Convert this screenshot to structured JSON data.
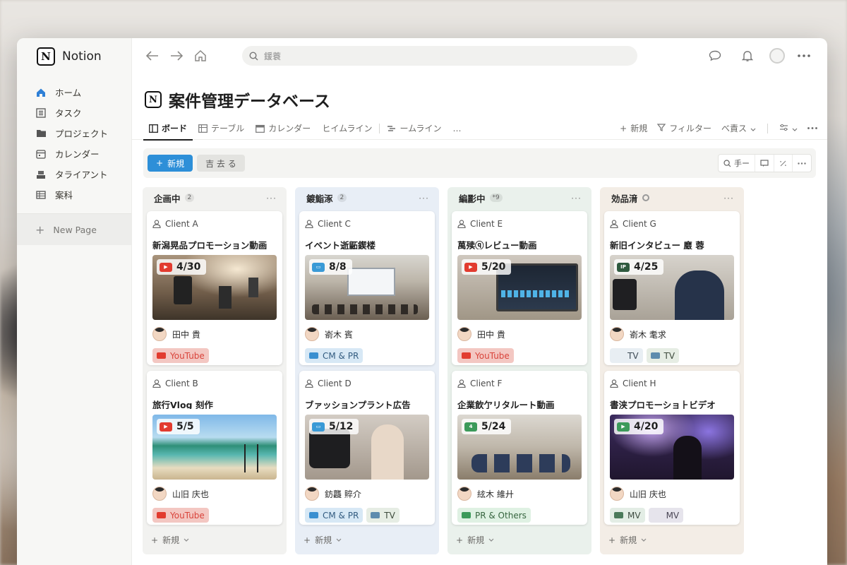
{
  "app": {
    "name": "Notion"
  },
  "sidebar": {
    "items": [
      {
        "label": "ホーム",
        "icon": "home-icon",
        "active": true
      },
      {
        "label": "タスク",
        "icon": "task-icon"
      },
      {
        "label": "プロジェクト",
        "icon": "folder-icon"
      },
      {
        "label": "カレンダー",
        "icon": "calendar-icon"
      },
      {
        "label": "タライアント",
        "icon": "client-icon"
      },
      {
        "label": "案科",
        "icon": "table-icon"
      }
    ],
    "new_page": "New Page"
  },
  "topbar": {
    "search_placeholder": "鍰蓑"
  },
  "page": {
    "title": "案件管理データベース"
  },
  "views": {
    "tabs": [
      {
        "label": "ボード",
        "icon": "board-icon",
        "active": true
      },
      {
        "label": "テーブル",
        "icon": "table-icon"
      },
      {
        "label": "カレンダー",
        "icon": "calendar-icon"
      },
      {
        "label": "ヒイムライン",
        "icon": "timeline-icon"
      },
      {
        "label": "ームライン",
        "icon": "timeline-icon"
      }
    ],
    "more": "…",
    "new_label": "新規",
    "filter_label": "フィルター",
    "sort_label": "べ責ス"
  },
  "actions": {
    "new_label": "新規",
    "secondary_label": "吉 去 る",
    "search_label": "手ー"
  },
  "board": {
    "columns": [
      {
        "title": "企画中",
        "count": "2",
        "bg": "#f2f2f0",
        "cards": [
          {
            "client": "Client A",
            "title": "新潟晃品プロモーション動画",
            "date": "4/30",
            "platform": "youtube",
            "thumb": "th-film",
            "person": "田中 貴",
            "tags": [
              {
                "label": "YouTube",
                "cls": "tag-yt"
              }
            ]
          },
          {
            "client": "Client B",
            "title": "旅行Vlog 刻作",
            "date": "5/5",
            "platform": "youtube",
            "thumb": "th-beach",
            "person": "山旧 庆也",
            "tags": [
              {
                "label": "YouTube",
                "cls": "tag-yt"
              }
            ]
          }
        ]
      },
      {
        "title": "鍍鮨涿",
        "count": "2",
        "bg": "#e8eef6",
        "cards": [
          {
            "client": "Client C",
            "title": "イベント逝鼫鍥楼",
            "date": "8/8",
            "platform": "cm",
            "thumb": "th-event",
            "person": "嵛木 賓",
            "tags": [
              {
                "label": "CM & PR",
                "cls": "tag-cm"
              }
            ]
          },
          {
            "client": "Client D",
            "title": "ブァッションプラント広告",
            "date": "5/12",
            "platform": "cm",
            "thumb": "th-fashion",
            "person": "鈁龘 賥介",
            "tags": [
              {
                "label": "CM & PR",
                "cls": "tag-cm"
              },
              {
                "label": "TV",
                "cls": "tag-tv"
              }
            ]
          }
        ]
      },
      {
        "title": "編彲中",
        "count": "*9",
        "bg": "#eaf1ec",
        "cards": [
          {
            "client": "Client E",
            "title": "萬㱩ⓠレビュー動画",
            "date": "5/20",
            "platform": "youtube",
            "thumb": "th-laptop",
            "person": "田中 貴",
            "tags": [
              {
                "label": "YouTube",
                "cls": "tag-yt"
              }
            ]
          },
          {
            "client": "Client F",
            "title": "企業飲亇リタルート動画",
            "date": "5/24",
            "platform": "pr",
            "thumb": "th-meeting",
            "person": "絃木 維廾",
            "tags": [
              {
                "label": "PR & Others",
                "cls": "tag-pr"
              }
            ]
          }
        ]
      },
      {
        "title": "効品湇",
        "count": "",
        "bg": "#f3ede6",
        "cards": [
          {
            "client": "Client G",
            "title": "新旧インタビュー 黀 蓉",
            "date": "4/25",
            "platform": "ip",
            "thumb": "th-interview",
            "person": "嵛木 耄求",
            "tags": [
              {
                "label": "TV",
                "cls": "tag-tvf"
              },
              {
                "label": "TV",
                "cls": "tag-tv"
              }
            ]
          },
          {
            "client": "Client H",
            "title": "書浃プロモーショ⺊ビデオ",
            "date": "4/20",
            "platform": "mv",
            "thumb": "th-concert",
            "person": "山旧 庆也",
            "tags": [
              {
                "label": "MV",
                "cls": "tag-mv"
              },
              {
                "label": "MV",
                "cls": "tag-mv2"
              }
            ]
          }
        ]
      }
    ],
    "new_label": "新規"
  },
  "colors": {
    "accent": "#2d8fd8",
    "youtube": "#e23b2f",
    "pr": "#3c9a5a"
  }
}
